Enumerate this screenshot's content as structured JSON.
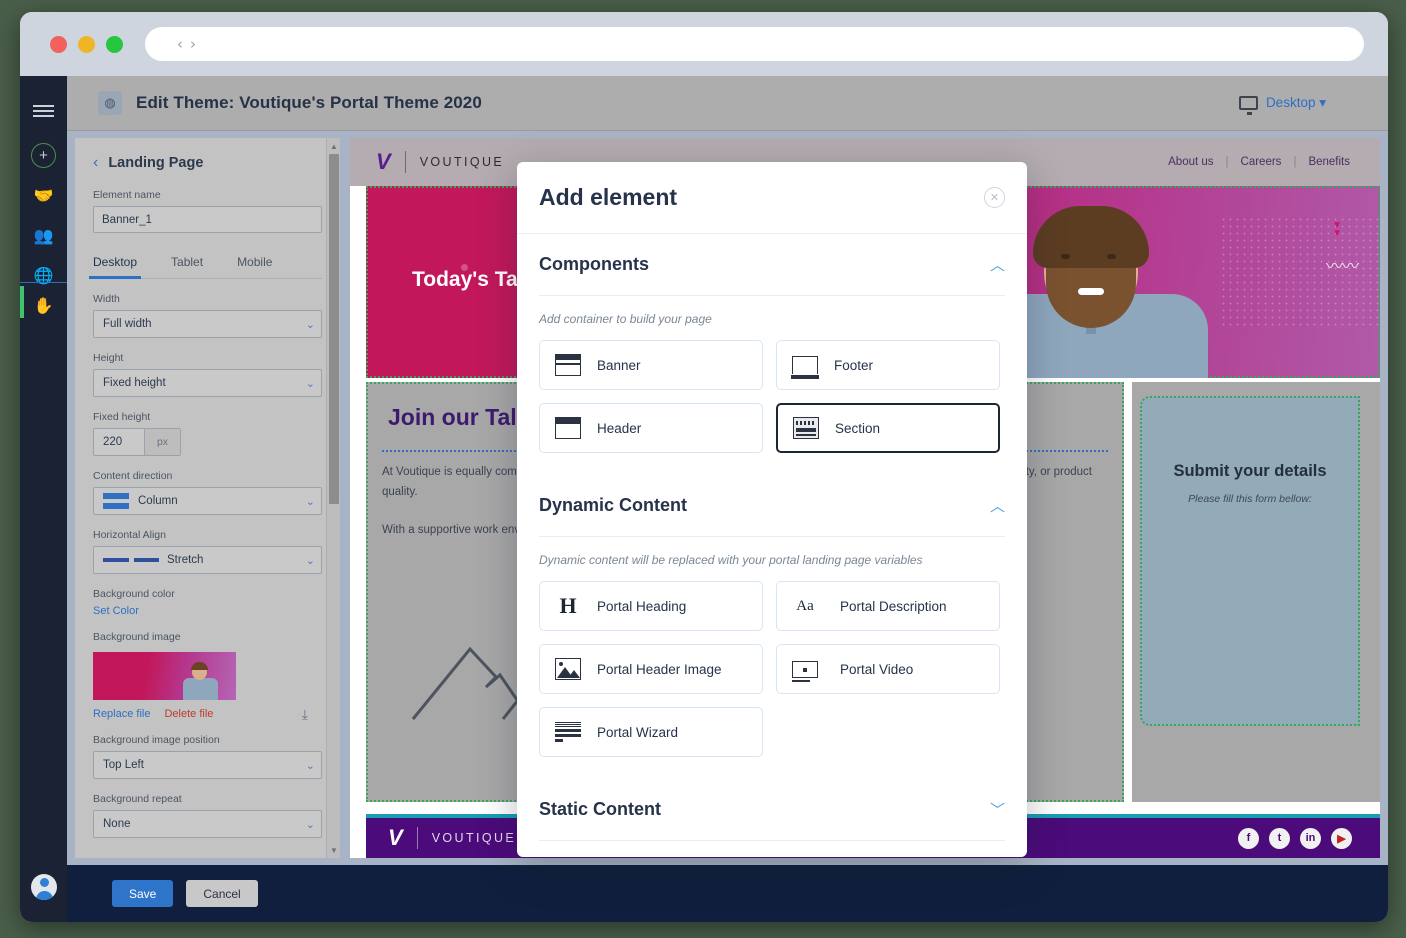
{
  "browser": {
    "nav_back": "‹",
    "nav_forward": "›",
    "url_value": ""
  },
  "app": {
    "title": "Edit Theme: Voutique's Portal Theme 2020",
    "logo_glyph": "◍",
    "view_mode": "Desktop ▾"
  },
  "rail": {
    "menu_icon": "hamburger-icon",
    "add_icon": "+",
    "icons": [
      "handshake-icon",
      "people-icon",
      "globe-icon",
      "hand-icon"
    ]
  },
  "properties": {
    "back_label": "Landing Page",
    "element_name_label": "Element name",
    "element_name_value": "Banner_1",
    "tabs": [
      {
        "label": "Desktop",
        "active": true
      },
      {
        "label": "Tablet",
        "active": false
      },
      {
        "label": "Mobile",
        "active": false
      }
    ],
    "fields": {
      "width_label": "Width",
      "width_value": "Full width",
      "height_label": "Height",
      "height_value": "Fixed height",
      "fixed_height_label": "Fixed height",
      "fixed_height_value": "220",
      "fixed_height_unit": "px",
      "content_direction_label": "Content direction",
      "content_direction_value": "Column",
      "horizontal_align_label": "Horizontal Align",
      "horizontal_align_value": "Stretch",
      "background_color_label": "Background color",
      "background_color_link": "Set Color",
      "background_image_label": "Background image",
      "replace_file_link": "Replace file",
      "delete_file_link": "Delete file",
      "bg_image_position_label": "Background image position",
      "bg_image_position_value": "Top Left",
      "bg_repeat_label": "Background repeat",
      "bg_repeat_value": "None"
    },
    "chevron": "⌄"
  },
  "canvas": {
    "brand_mark": "V",
    "brand_name": "VOUTIQUE",
    "nav": [
      "About us",
      "Careers",
      "Benefits"
    ],
    "nav_separator": "|",
    "hero_title": "Today's Talent",
    "join_title": "Join our Talent",
    "paragraph_1": "At Voutique is equally committed to our reputation for fostering innovation. Risk-taking and experimentation without responsibility, or product quality.",
    "paragraph_2": "With a supportive work environment and commitment to the company values.",
    "form_title": "Submit your details",
    "form_subtitle": "Please fill this form bellow:",
    "socials": [
      "f",
      "t",
      "in",
      "▶"
    ]
  },
  "actionbar": {
    "save_label": "Save",
    "cancel_label": "Cancel"
  },
  "modal": {
    "title": "Add element",
    "close_glyph": "✕",
    "sections": [
      {
        "title": "Components",
        "caret": "︿",
        "description": "Add container to build your page",
        "cards": [
          {
            "label": "Banner",
            "icon": "banner-icon",
            "selected": false
          },
          {
            "label": "Footer",
            "icon": "footer-icon",
            "selected": false
          },
          {
            "label": "Header",
            "icon": "header-icon",
            "selected": false
          },
          {
            "label": "Section",
            "icon": "section-icon",
            "selected": true
          }
        ]
      },
      {
        "title": "Dynamic Content",
        "caret": "︿",
        "description": "Dynamic content will be replaced with your portal landing page variables",
        "cards": [
          {
            "label": "Portal Heading",
            "icon": "heading-icon",
            "selected": false
          },
          {
            "label": "Portal Description",
            "icon": "text-icon",
            "selected": false
          },
          {
            "label": "Portal Header Image",
            "icon": "image-icon",
            "selected": false
          },
          {
            "label": "Portal Video",
            "icon": "video-icon",
            "selected": false
          },
          {
            "label": "Portal Wizard",
            "icon": "wizard-icon",
            "selected": false
          }
        ]
      },
      {
        "title": "Static Content",
        "caret": "﹀",
        "description": "",
        "cards": []
      }
    ]
  },
  "colors": {
    "accent_blue": "#2f6fc4",
    "modal_caret": "#4aa3e8",
    "brand_purple": "#4b0b7a",
    "hero_pink": "#c2185b",
    "rail_dark": "#1b2233"
  }
}
